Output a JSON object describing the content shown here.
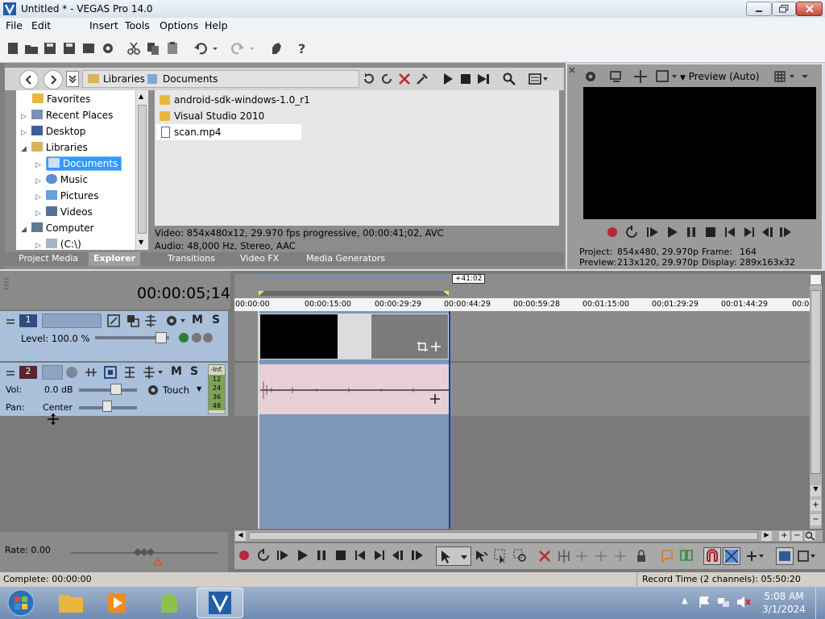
{
  "window": {
    "title": "Untitled * - VEGAS Pro 14.0"
  },
  "menu": [
    "File",
    "Edit",
    "Insert",
    "Tools",
    "Options",
    "Help"
  ],
  "explorer": {
    "breadcrumb": [
      "Libraries",
      "Documents"
    ],
    "tree": [
      {
        "label": "Favorites",
        "indent": 1
      },
      {
        "label": "Recent Places",
        "indent": 1
      },
      {
        "label": "Desktop",
        "indent": 1
      },
      {
        "label": "Libraries",
        "indent": 1
      },
      {
        "label": "Documents",
        "indent": 2,
        "selected": true
      },
      {
        "label": "Music",
        "indent": 2
      },
      {
        "label": "Pictures",
        "indent": 2
      },
      {
        "label": "Videos",
        "indent": 2
      },
      {
        "label": "Computer",
        "indent": 1
      },
      {
        "label": "(C:\\)",
        "indent": 2
      }
    ],
    "files": [
      {
        "name": "android-sdk-windows-1.0_r1",
        "type": "folder"
      },
      {
        "name": "Visual Studio 2010",
        "type": "folder"
      },
      {
        "name": "scan.mp4",
        "type": "file",
        "selected": true
      }
    ],
    "info_video": "Video: 854x480x12, 29.970 fps progressive, 00:00:41;02, AVC",
    "info_audio": "Audio: 48,000 Hz, Stereo, AAC",
    "tabs": [
      "Project Media",
      "Explorer",
      "Transitions",
      "Video FX",
      "Media Generators"
    ],
    "active_tab": "Explorer"
  },
  "preview": {
    "mode": "Preview (Auto)",
    "project_label": "Project:",
    "project_value": "854x480, 29.970p",
    "preview_label": "Preview:",
    "preview_value": "213x120, 29.970p",
    "frame_label": "Frame:",
    "frame_value": "164",
    "display_label": "Display:",
    "display_value": "289x163x32"
  },
  "timeline": {
    "timecode": "00:00:05;14",
    "region_len": "+41:02",
    "ruler": [
      "00:00:00",
      "00:00:15:00",
      "00:00:29:29",
      "00:00:44:29",
      "00:00:59:28",
      "00:01:15:00",
      "00:01:29:29",
      "00:01:44:29",
      "00:0"
    ],
    "track1": {
      "number": "1",
      "level": "Level: 100.0 %",
      "mute": "M",
      "solo": "S"
    },
    "track2": {
      "number": "2",
      "vol_label": "Vol:",
      "vol": "0.0 dB",
      "pan_label": "Pan:",
      "pan": "Center",
      "automation": "Touch",
      "mute": "M",
      "solo": "S",
      "meter": [
        "-Inf.",
        "12",
        "24",
        "36",
        "48"
      ]
    },
    "rate": "Rate: 0.00"
  },
  "status": {
    "left": "Complete: 00:00:00",
    "right": "Record Time (2 channels): 05:50:20"
  },
  "taskbar": {
    "time": "5:08 AM",
    "date": "3/1/2024"
  }
}
